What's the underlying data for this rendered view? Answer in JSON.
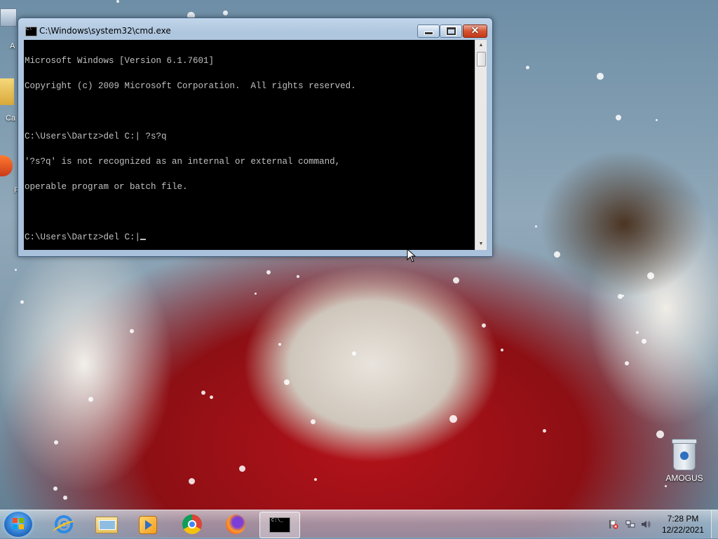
{
  "window": {
    "title": "C:\\Windows\\system32\\cmd.exe",
    "buttons": {
      "minimize": "minimize",
      "maximize": "maximize",
      "close": "✕"
    },
    "console_lines": [
      "Microsoft Windows [Version 6.1.7601]",
      "Copyright (c) 2009 Microsoft Corporation.  All rights reserved.",
      "",
      "C:\\Users\\Dartz>del C:| ?s?q",
      "'?s?q' is not recognized as an internal or external command,",
      "operable program or batch file.",
      "",
      "C:\\Users\\Dartz>del C:|"
    ]
  },
  "desktop": {
    "recycle_bin_label": "AMOGUS",
    "partial_labels": [
      "A",
      "Ca",
      "F"
    ]
  },
  "taskbar": {
    "pinned": [
      "start-button",
      "internet-explorer-icon",
      "file-explorer-icon",
      "windows-media-player-icon",
      "chrome-icon",
      "firefox-icon",
      "cmd-icon"
    ],
    "active": "cmd",
    "cmd_icon_text": "C:\\_",
    "clock_time": "7:28 PM",
    "clock_date": "12/22/2021"
  }
}
